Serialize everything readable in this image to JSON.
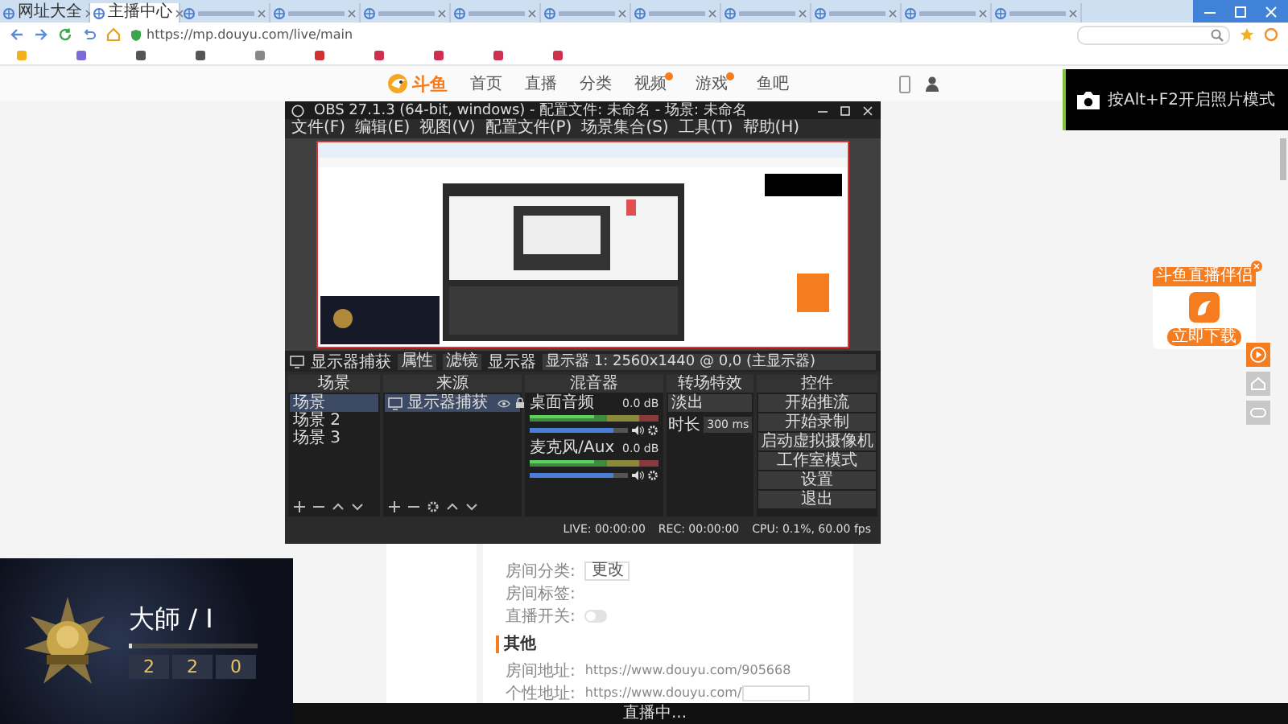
{
  "browser": {
    "tabs": [
      {
        "label": "网址大全",
        "selected": false
      },
      {
        "label": "主播中心",
        "selected": true
      },
      {
        "selected": false
      },
      {
        "selected": false
      },
      {
        "selected": false
      },
      {
        "selected": false
      },
      {
        "selected": false
      },
      {
        "selected": false
      },
      {
        "selected": false
      },
      {
        "selected": false
      },
      {
        "selected": false
      },
      {
        "selected": false
      }
    ],
    "address": "https://mp.douyu.com/live/main"
  },
  "site": {
    "logo": "斗鱼",
    "nav": [
      {
        "label": "首页",
        "dot": false
      },
      {
        "label": "直播",
        "dot": false
      },
      {
        "label": "分类",
        "dot": false
      },
      {
        "label": "视频",
        "dot": true
      },
      {
        "label": "游戏",
        "dot": true
      },
      {
        "label": "鱼吧",
        "dot": false
      }
    ]
  },
  "settings": {
    "rows": [
      {
        "kind": "link",
        "label": "房间分类:",
        "action": "更改"
      },
      {
        "kind": "empty",
        "label": "房间标签:"
      },
      {
        "kind": "toggle",
        "label": "直播开关:",
        "on": false
      }
    ],
    "section": "其他",
    "addresses": [
      {
        "kind": "text",
        "label": "房间地址:",
        "value": "https://www.douyu.com/905668"
      },
      {
        "kind": "input",
        "label": "个性地址:",
        "value": "https://www.douyu.com/"
      }
    ]
  },
  "toast": "按Alt+F2开启照片模式",
  "widget": {
    "title": "斗鱼直播伴侣",
    "button": "立即下载"
  },
  "obs": {
    "title": "OBS 27.1.3 (64-bit, windows) - 配置文件: 未命名 - 场景: 未命名",
    "menu": [
      "文件(F)",
      "编辑(E)",
      "视图(V)",
      "配置文件(P)",
      "场景集合(S)",
      "工具(T)",
      "帮助(H)"
    ],
    "toolbar": {
      "source": "显示器捕获",
      "buttons": [
        "属性",
        "滤镜"
      ],
      "display_label": "显示器",
      "display_value": "显示器 1: 2560x1440 @ 0,0 (主显示器)"
    },
    "scenes": {
      "title": "场景",
      "items": [
        {
          "label": "场景",
          "selected": true
        },
        {
          "label": "场景 2",
          "selected": false
        },
        {
          "label": "场景 3",
          "selected": false
        }
      ]
    },
    "sources": {
      "title": "来源",
      "items": [
        {
          "label": "显示器捕获",
          "selected": true
        }
      ]
    },
    "mixer": {
      "title": "混音器",
      "channels": [
        {
          "name": "桌面音频",
          "reading": "0.0 dB",
          "level": 0.85
        },
        {
          "name": "麦克风/Aux",
          "reading": "0.0 dB",
          "level": 0.85
        }
      ]
    },
    "transitions": {
      "title": "转场特效",
      "type": "淡出",
      "duration_label": "时长",
      "duration": "300 ms"
    },
    "controls": {
      "title": "控件",
      "buttons": [
        "开始推流",
        "开始录制",
        "启动虚拟摄像机",
        "工作室模式",
        "设置",
        "退出"
      ]
    },
    "status": [
      "LIVE: 00:00:00",
      "REC: 00:00:00",
      "CPU: 0.1%, 60.00 fps"
    ]
  },
  "game_overlay": {
    "rank": "大師 / I",
    "level": 0.03,
    "stats": [
      "2",
      "2",
      "0"
    ]
  },
  "live_bar": "直播中..."
}
